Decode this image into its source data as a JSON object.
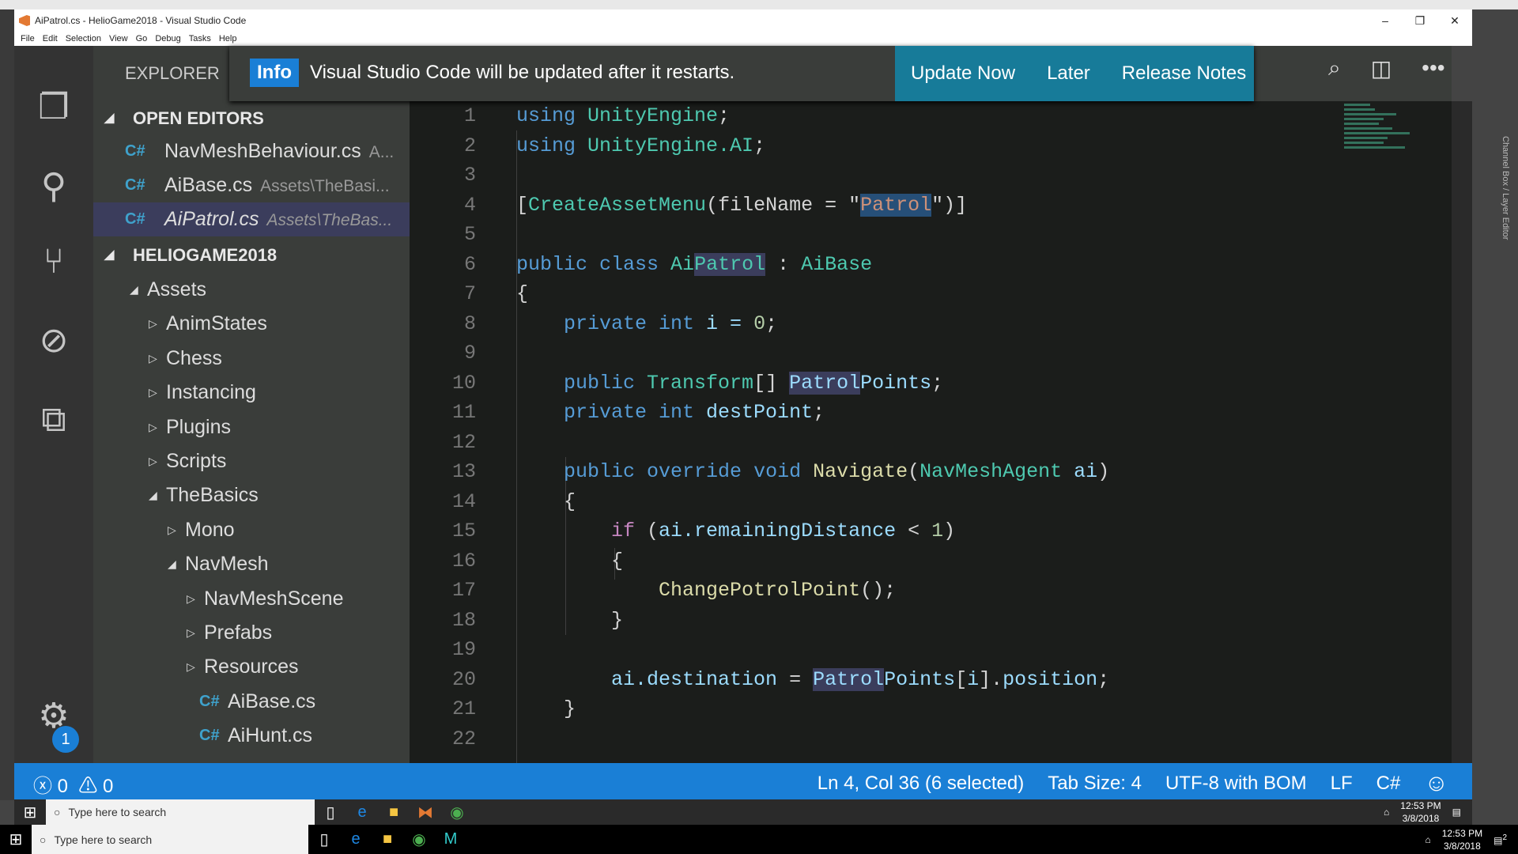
{
  "window": {
    "title": "AiPatrol.cs - HelioGame2018 - Visual Studio Code",
    "menu": [
      "File",
      "Edit",
      "Selection",
      "View",
      "Go",
      "Debug",
      "Tasks",
      "Help"
    ]
  },
  "maya": {
    "side_label": "Channel Box / Layer Editor"
  },
  "sidebar": {
    "title": "EXPLORER",
    "open_editors_label": "OPEN EDITORS",
    "project_label": "HELIOGAME2018",
    "open_editors": [
      {
        "name": "NavMeshBehaviour.cs",
        "path": "A..."
      },
      {
        "name": "AiBase.cs",
        "path": "Assets\\TheBasi..."
      },
      {
        "name": "AiPatrol.cs",
        "path": "Assets\\TheBas...",
        "selected": true
      }
    ],
    "tree": [
      {
        "label": "Assets",
        "depth": 0,
        "state": "open"
      },
      {
        "label": "AnimStates",
        "depth": 1,
        "state": "closed"
      },
      {
        "label": "Chess",
        "depth": 1,
        "state": "closed"
      },
      {
        "label": "Instancing",
        "depth": 1,
        "state": "closed"
      },
      {
        "label": "Plugins",
        "depth": 1,
        "state": "closed"
      },
      {
        "label": "Scripts",
        "depth": 1,
        "state": "closed"
      },
      {
        "label": "TheBasics",
        "depth": 1,
        "state": "open"
      },
      {
        "label": "Mono",
        "depth": 2,
        "state": "closed"
      },
      {
        "label": "NavMesh",
        "depth": 2,
        "state": "open"
      },
      {
        "label": "NavMeshScene",
        "depth": 3,
        "state": "closed"
      },
      {
        "label": "Prefabs",
        "depth": 3,
        "state": "closed"
      },
      {
        "label": "Resources",
        "depth": 3,
        "state": "closed"
      },
      {
        "label": "AiBase.cs",
        "depth": 3,
        "state": "file"
      },
      {
        "label": "AiHunt.cs",
        "depth": 3,
        "state": "file"
      }
    ]
  },
  "activity": {
    "settings_badge": "1"
  },
  "notification": {
    "badge": "Info",
    "message": "Visual Studio Code will be updated after it restarts.",
    "buttons": [
      "Update Now",
      "Later",
      "Release Notes"
    ]
  },
  "editor": {
    "lines": [
      [
        [
          "using ",
          "kw"
        ],
        [
          "UnityEngine",
          "type"
        ],
        [
          ";",
          "p"
        ]
      ],
      [
        [
          "using ",
          "kw"
        ],
        [
          "UnityEngine.AI",
          "type"
        ],
        [
          ";",
          "p"
        ]
      ],
      [],
      [
        [
          "[",
          "p"
        ],
        [
          "CreateAssetMenu",
          "type"
        ],
        [
          "(fileName = \"",
          "p"
        ],
        [
          "Patrol",
          "str hls"
        ],
        [
          "\")]",
          "p"
        ]
      ],
      [],
      [
        [
          "public ",
          "kw"
        ],
        [
          "class ",
          "kw"
        ],
        [
          "Ai",
          "type"
        ],
        [
          "Patrol",
          "type hl"
        ],
        [
          " : ",
          "p"
        ],
        [
          "AiBase",
          "type"
        ]
      ],
      [
        [
          "{",
          "p"
        ]
      ],
      [
        [
          "    private ",
          "kw"
        ],
        [
          "int ",
          "kw"
        ],
        [
          "i = ",
          "var"
        ],
        [
          "0",
          "num"
        ],
        [
          ";",
          "p"
        ]
      ],
      [],
      [
        [
          "    public ",
          "kw"
        ],
        [
          "Transform",
          "type"
        ],
        [
          "[] ",
          "p"
        ],
        [
          "Patrol",
          "var hl"
        ],
        [
          "Points",
          "var"
        ],
        [
          ";",
          "p"
        ]
      ],
      [
        [
          "    private ",
          "kw"
        ],
        [
          "int ",
          "kw"
        ],
        [
          "destPoint",
          "var"
        ],
        [
          ";",
          "p"
        ]
      ],
      [],
      [
        [
          "    public ",
          "kw"
        ],
        [
          "override ",
          "kw"
        ],
        [
          "void ",
          "kw"
        ],
        [
          "Navigate",
          "fn"
        ],
        [
          "(",
          "p"
        ],
        [
          "NavMeshAgent ",
          "type"
        ],
        [
          "ai",
          "var"
        ],
        [
          ")",
          "p"
        ]
      ],
      [
        [
          "    {",
          "p"
        ]
      ],
      [
        [
          "        if ",
          "ctl"
        ],
        [
          "(",
          "p"
        ],
        [
          "ai.remainingDistance",
          "var"
        ],
        [
          " < ",
          "p"
        ],
        [
          "1",
          "num"
        ],
        [
          ")",
          "p"
        ]
      ],
      [
        [
          "        {",
          "p"
        ]
      ],
      [
        [
          "            ChangePotrolPoint",
          "fn"
        ],
        [
          "();",
          "p"
        ]
      ],
      [
        [
          "        }",
          "p"
        ]
      ],
      [],
      [
        [
          "        ai.destination",
          "var"
        ],
        [
          " = ",
          "p"
        ],
        [
          "Patrol",
          "var hl"
        ],
        [
          "Points",
          "var"
        ],
        [
          "[",
          "p"
        ],
        [
          "i",
          "var"
        ],
        [
          "].",
          "p"
        ],
        [
          "position",
          "var"
        ],
        [
          ";",
          "p"
        ]
      ],
      [
        [
          "    }",
          "p"
        ]
      ],
      []
    ]
  },
  "status": {
    "errors": "0",
    "warnings": "0",
    "position": "Ln 4, Col 36 (6 selected)",
    "tab_size": "Tab Size: 4",
    "encoding": "UTF-8 with BOM",
    "eol": "LF",
    "language": "C#"
  },
  "taskbar": {
    "search_placeholder": "Type here to search",
    "time": "12:53 PM",
    "date": "3/8/2018",
    "notifications": "2"
  }
}
